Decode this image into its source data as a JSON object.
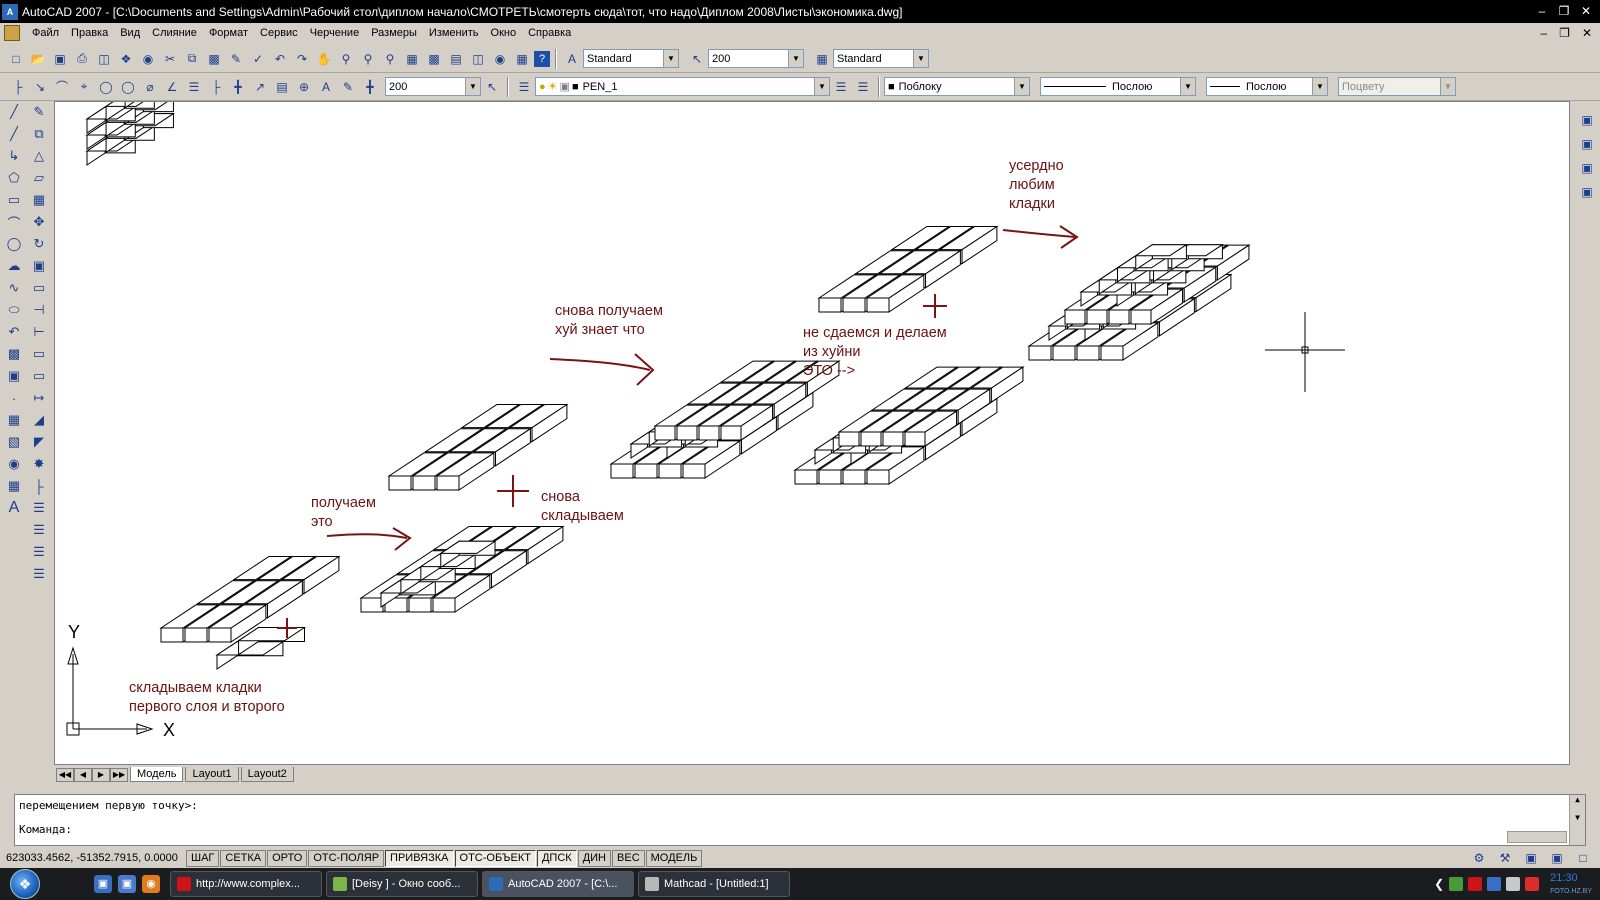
{
  "window": {
    "title": "AutoCAD 2007 - [C:\\Documents and Settings\\Admin\\Рабочий стол\\диплом начало\\СМОТРЕТЬ\\смотерть сюда\\тот, что надо\\Диплом 2008\\Листы\\экономика.dwg]",
    "icon_text": "A"
  },
  "menu": {
    "items": [
      "Файл",
      "Правка",
      "Вид",
      "Слияние",
      "Формат",
      "Сервис",
      "Черчение",
      "Размеры",
      "Изменить",
      "Окно",
      "Справка"
    ]
  },
  "toolbar1": {
    "text_style": "Standard",
    "dim_scale": "200",
    "table_style": "Standard"
  },
  "toolbar2": {
    "dim_value": "200",
    "layer": "PEN_1",
    "color": "Поблоку",
    "linetype": "Послою",
    "lineweight": "Послою",
    "plotstyle": "Поцвету"
  },
  "annotations": {
    "a1": "складываем кладки\nпервого слоя и второго",
    "a2": "получаем\nэто",
    "a3": "снова\nскладываем",
    "a4": "снова получаем\nхуй знает что",
    "a5": "не сдаемся и делаем\nиз хуйни\nЭТО -->",
    "a6": "усердно\nлюбим\nкладки"
  },
  "ucs": {
    "x": "X",
    "y": "Y"
  },
  "tabs": [
    "Модель",
    "Layout1",
    "Layout2"
  ],
  "command": {
    "line1": "перемещением первую точку>:",
    "line2": "Команда:"
  },
  "status": {
    "coords": "623033.4562, -51352.7915, 0.0000",
    "buttons": [
      "ШАГ",
      "СЕТКА",
      "ОРТО",
      "ОТС-ПОЛЯР",
      "ПРИВЯЗКА",
      "ОТС-ОБЪЕКТ",
      "ДПСК",
      "ДИН",
      "ВЕС",
      "МОДЕЛЬ"
    ]
  },
  "taskbar": {
    "tasks": [
      "http://www.complex...",
      "[Deisy ] - Окно сооб...",
      "AutoCAD 2007 - [C:\\...",
      "Mathcad - [Untitled:1]"
    ],
    "clock": "21:30",
    "watermark": "FOTO.HZ.BY"
  },
  "colors": {
    "annotation": "#6b1212",
    "titlebar": "#000000",
    "canvas": "#ffffff"
  }
}
